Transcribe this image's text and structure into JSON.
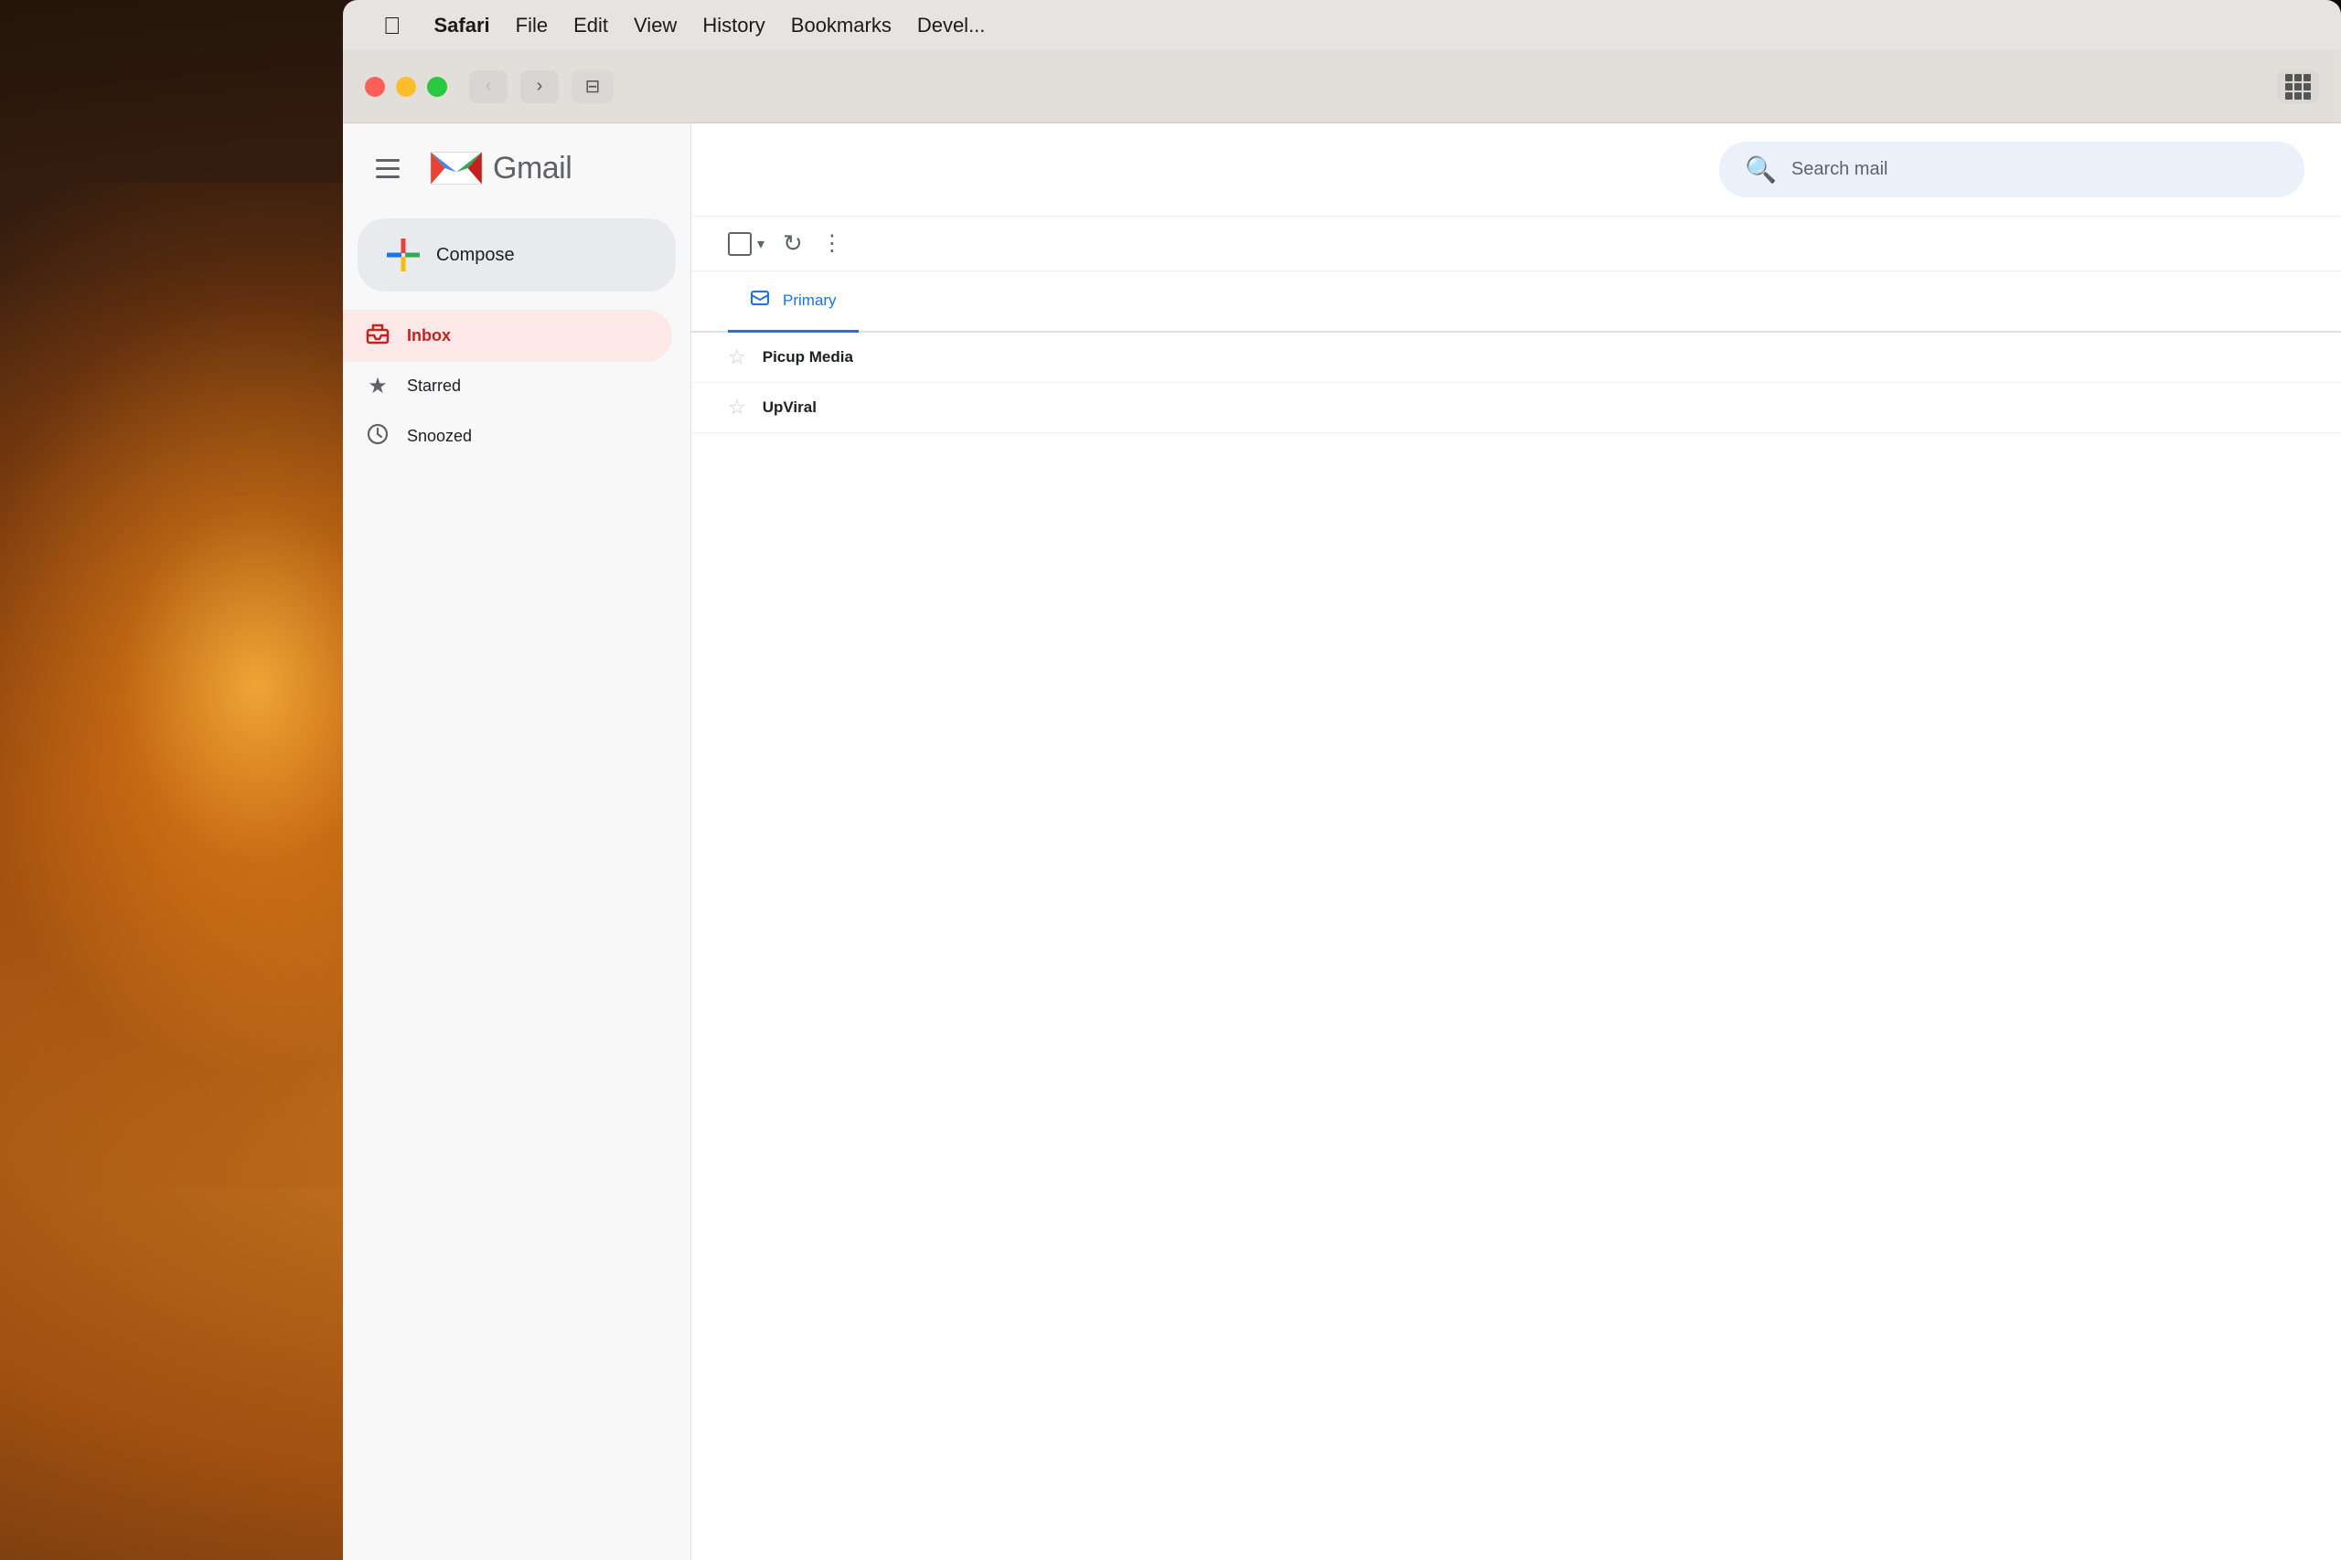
{
  "background": {
    "color": "#1a1008"
  },
  "menubar": {
    "apple_label": "",
    "items": [
      {
        "id": "safari",
        "label": "Safari",
        "bold": true
      },
      {
        "id": "file",
        "label": "File",
        "bold": false
      },
      {
        "id": "edit",
        "label": "Edit",
        "bold": false
      },
      {
        "id": "view",
        "label": "View",
        "bold": false
      },
      {
        "id": "history",
        "label": "History",
        "bold": false
      },
      {
        "id": "bookmarks",
        "label": "Bookmarks",
        "bold": false
      },
      {
        "id": "develop",
        "label": "Devel...",
        "bold": false
      }
    ]
  },
  "safari_toolbar": {
    "back_label": "‹",
    "forward_label": "›",
    "sidebar_label": "⊞"
  },
  "gmail": {
    "app_name": "Gmail",
    "search_placeholder": "Search mail",
    "compose_label": "Compose",
    "nav_items": [
      {
        "id": "inbox",
        "label": "Inbox",
        "active": true
      },
      {
        "id": "starred",
        "label": "Starred",
        "active": false
      },
      {
        "id": "snoozed",
        "label": "Snoozed",
        "active": false
      }
    ],
    "tabs": [
      {
        "id": "primary",
        "label": "Primary",
        "active": true
      }
    ],
    "emails": [
      {
        "sender": "Picup Media",
        "star": false
      },
      {
        "sender": "UpViral",
        "star": false
      }
    ]
  }
}
